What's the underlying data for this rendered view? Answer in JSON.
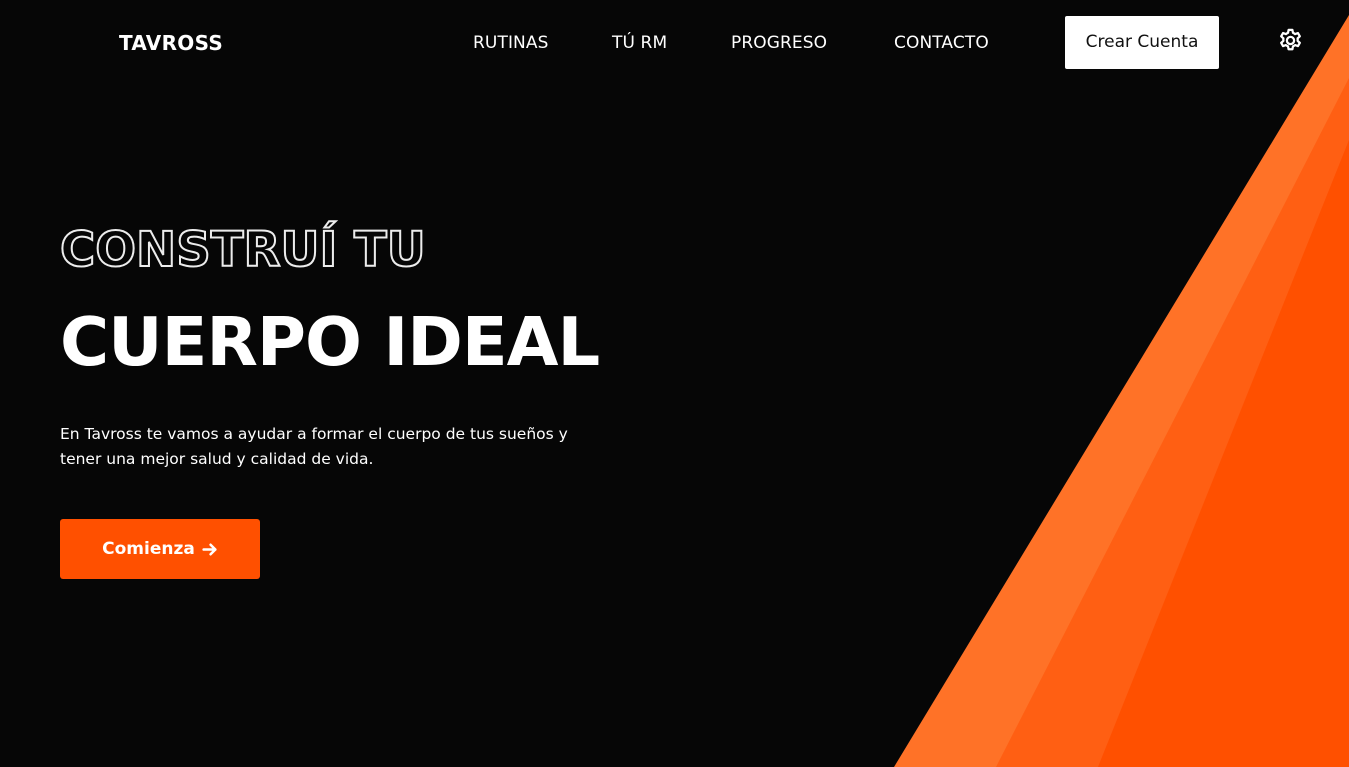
{
  "brand": {
    "name": "TAVROSS"
  },
  "nav": {
    "items": [
      {
        "label": "RUTINAS"
      },
      {
        "label": "TÚ RM"
      },
      {
        "label": "PROGRESO"
      },
      {
        "label": "CONTACTO"
      }
    ],
    "create_account_label": "Crear Cuenta",
    "settings_icon": "gear-icon"
  },
  "hero": {
    "headline_outline": "CONSTRUÍ TU",
    "headline_solid": "CUERPO IDEAL",
    "description": "En Tavross te vamos a ayudar a formar el cuerpo de tus sueños y tener una mejor salud y calidad de vida.",
    "cta_label": "Comienza",
    "cta_icon": "arrow-right-icon"
  },
  "colors": {
    "background": "#060606",
    "accent": "#ff5000",
    "accent_light": "#ff7227",
    "accent_mid": "#ff5f13",
    "text": "#ffffff"
  }
}
